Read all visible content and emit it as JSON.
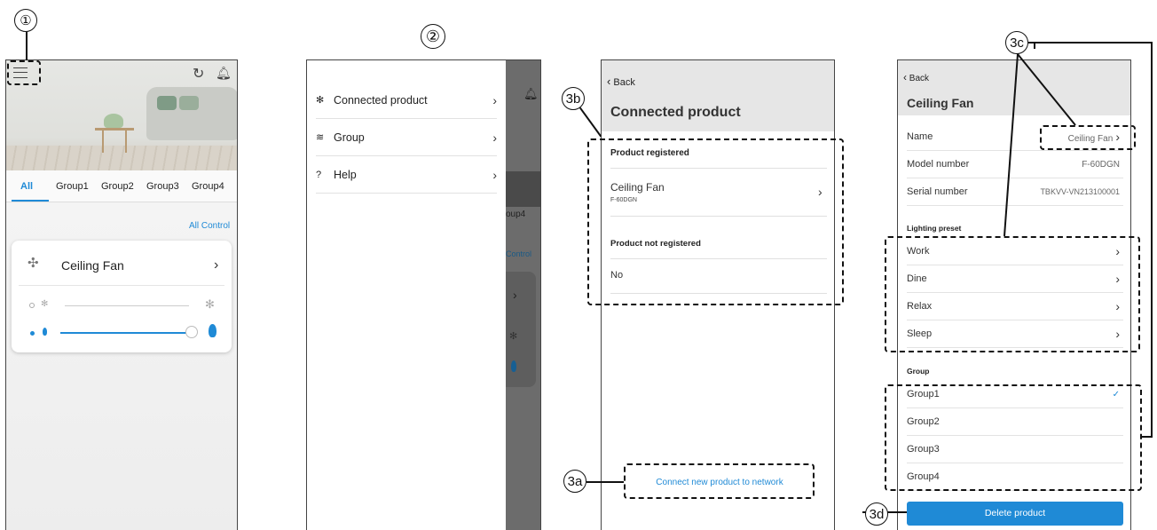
{
  "callouts": {
    "c1": "①",
    "c2": "②",
    "c3a": "3a",
    "c3b": "3b",
    "c3c": "3c",
    "c3d": "3d"
  },
  "screen1": {
    "tabs": [
      "All",
      "Group1",
      "Group2",
      "Group3",
      "Group4"
    ],
    "all_control": "All Control",
    "device_name": "Ceiling Fan",
    "fan_slider_level": 0,
    "light_slider_level": 1.0
  },
  "screen2": {
    "menu": [
      "Connected product",
      "Group",
      "Help"
    ],
    "peek_tab": "oup4",
    "peek_control": "Control"
  },
  "screen3": {
    "back": "Back",
    "title": "Connected product",
    "registered_header": "Product registered",
    "product_name": "Ceiling Fan",
    "product_model": "F-60DGN",
    "not_registered_header": "Product not registered",
    "not_registered_value": "No",
    "connect_link": "Connect new product to network"
  },
  "screen4": {
    "back": "Back",
    "title": "Ceiling Fan",
    "name_label": "Name",
    "name_value": "Ceiling Fan",
    "model_label": "Model number",
    "model_value": "F-60DGN",
    "serial_label": "Serial number",
    "serial_value": "TBKVV-VN213100001",
    "lighting_header": "Lighting preset",
    "presets": [
      "Work",
      "Dine",
      "Relax",
      "Sleep"
    ],
    "group_header": "Group",
    "groups": [
      "Group1",
      "Group2",
      "Group3",
      "Group4"
    ],
    "selected_group": "Group1",
    "delete_button": "Delete product"
  },
  "colors": {
    "accent": "#1f8ad6",
    "header_gray": "#e6e6e6"
  }
}
